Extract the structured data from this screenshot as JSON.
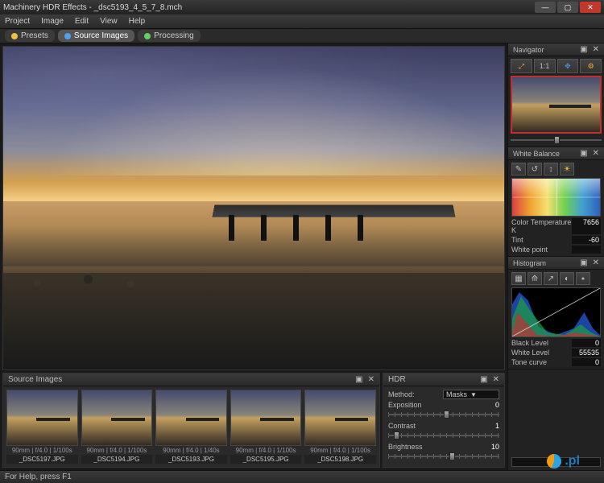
{
  "window": {
    "title": "Machinery HDR Effects - _dsc5193_4_5_7_8.mch"
  },
  "menu": [
    "Project",
    "Image",
    "Edit",
    "View",
    "Help"
  ],
  "tabs": [
    {
      "label": "Presets",
      "active": false,
      "dot": "#f0c040"
    },
    {
      "label": "Source Images",
      "active": true,
      "dot": "#50a0f0"
    },
    {
      "label": "Processing",
      "active": false,
      "dot": "#60d060"
    }
  ],
  "sourcePanel": {
    "title": "Source Images",
    "thumbs": [
      {
        "meta": "90mm | f/4.0 | 1/100s",
        "name": "_DSC5197.JPG"
      },
      {
        "meta": "90mm | f/4.0 | 1/100s",
        "name": "_DSC5194.JPG"
      },
      {
        "meta": "90mm | f/4.0 | 1/40s",
        "name": "_DSC5193.JPG"
      },
      {
        "meta": "90mm | f/4.0 | 1/100s",
        "name": "_DSC5195.JPG"
      },
      {
        "meta": "90mm | f/4.0 | 1/100s",
        "name": "_DSC5198.JPG"
      }
    ]
  },
  "hdr": {
    "title": "HDR",
    "methodLabel": "Method:",
    "methodValue": "Masks",
    "params": [
      {
        "label": "Exposition",
        "value": "0",
        "pos": 50
      },
      {
        "label": "Contrast",
        "value": "1",
        "pos": 5
      },
      {
        "label": "Brightness",
        "value": "10",
        "pos": 55
      }
    ]
  },
  "navigator": {
    "title": "Navigator",
    "buttons": [
      "⤢",
      "1:1",
      "✥",
      "⚙"
    ]
  },
  "whiteBalance": {
    "title": "White Balance",
    "buttons": [
      "✎",
      "↺",
      "↕",
      "☀"
    ],
    "rows": [
      {
        "label": "Color Temperature K",
        "value": "7656"
      },
      {
        "label": "Tint",
        "value": "-60"
      },
      {
        "label": "White point",
        "value": ""
      }
    ]
  },
  "histogram": {
    "title": "Histogram",
    "buttons": [
      "▦",
      "⟰",
      "↗",
      "◐",
      "⭑"
    ],
    "rows": [
      {
        "label": "Black Level",
        "value": "0"
      },
      {
        "label": "White Level",
        "value": "55535"
      },
      {
        "label": "Tone curve",
        "value": "0"
      }
    ]
  },
  "progress": {
    "percent": "0%"
  },
  "status": {
    "text": "For Help, press F1"
  },
  "watermark": {
    "text": ".pl"
  }
}
